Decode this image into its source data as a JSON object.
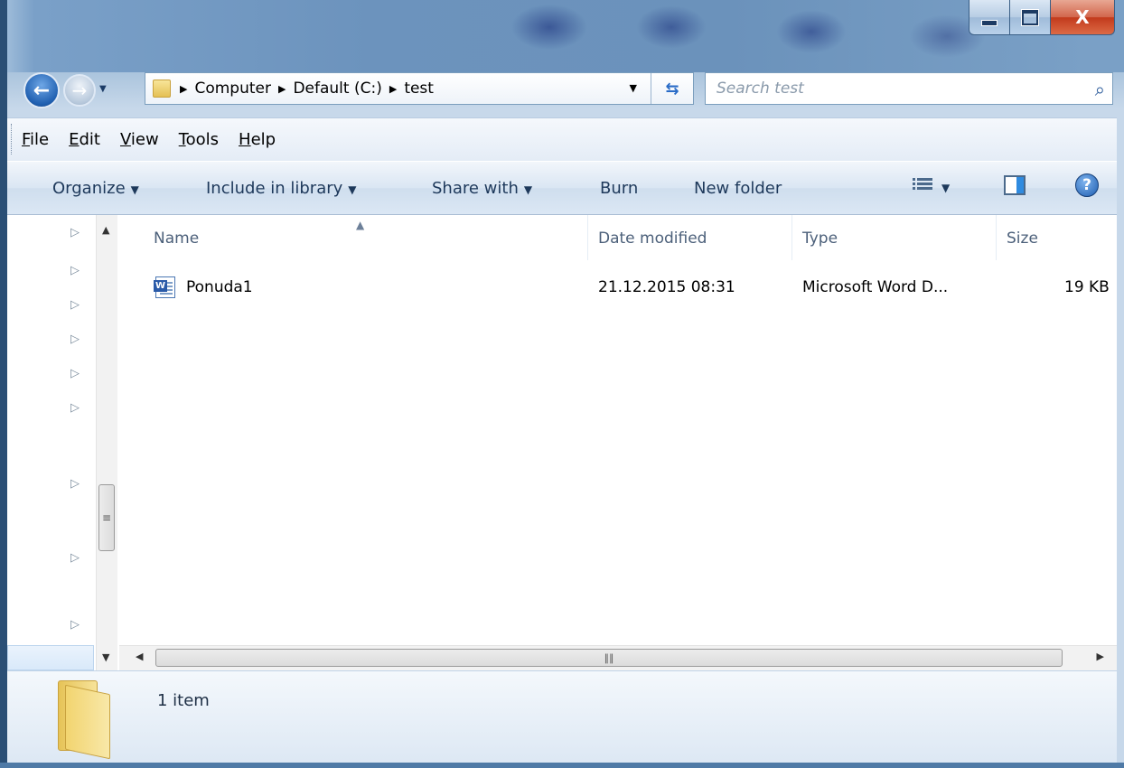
{
  "window": {
    "caption": {
      "minimize": "",
      "maximize": "",
      "close": "X"
    }
  },
  "address": {
    "crumbs": [
      "Computer",
      "Default (C:)",
      "test"
    ]
  },
  "search": {
    "placeholder": "Search test"
  },
  "menubar": {
    "items": [
      {
        "label": "File",
        "accel": "F"
      },
      {
        "label": "Edit",
        "accel": "E"
      },
      {
        "label": "View",
        "accel": "V"
      },
      {
        "label": "Tools",
        "accel": "T"
      },
      {
        "label": "Help",
        "accel": "H"
      }
    ]
  },
  "commandbar": {
    "organize": "Organize",
    "include": "Include in library",
    "share": "Share with",
    "burn": "Burn",
    "new_folder": "New folder",
    "help_glyph": "?"
  },
  "columns": {
    "name": "Name",
    "date": "Date modified",
    "type": "Type",
    "size": "Size"
  },
  "files": [
    {
      "name": "Ponuda1",
      "date": "21.12.2015 08:31",
      "type": "Microsoft Word D...",
      "size": "19 KB",
      "icon": "word-document-icon"
    }
  ],
  "statusbar": {
    "item_count": "1 item"
  },
  "icons": {
    "back": "back-arrow-icon",
    "forward": "forward-arrow-icon",
    "search": "search-icon",
    "refresh": "refresh-icon",
    "view": "view-options-icon",
    "preview": "preview-pane-icon",
    "help": "help-icon"
  },
  "colors": {
    "accent": "#1f5fb0",
    "close_button": "#c23a1c",
    "titlebar": "#6b92bb"
  }
}
